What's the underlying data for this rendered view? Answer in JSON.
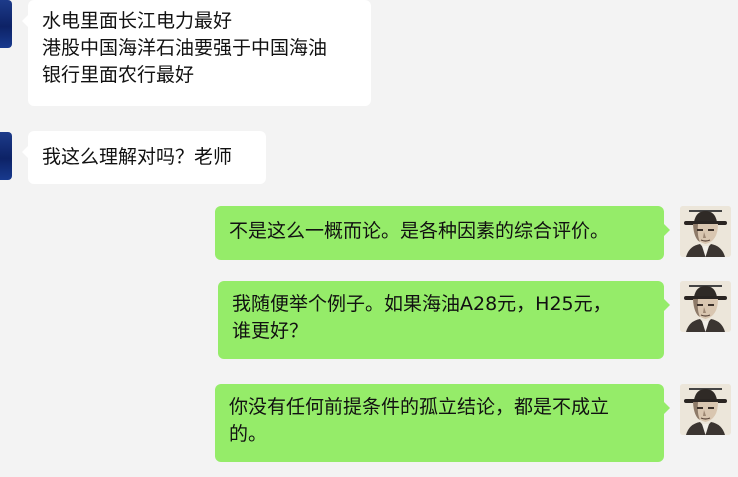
{
  "chat": {
    "messages": [
      {
        "side": "left",
        "lines": [
          "水电里面长江电力最好",
          "港股中国海洋石油要强于中国海油",
          "银行里面农行最好"
        ]
      },
      {
        "side": "left",
        "lines": [
          "我这么理解对吗？老师"
        ]
      },
      {
        "side": "right",
        "lines": [
          "不是这么一概而论。是各种因素的综合评价。"
        ]
      },
      {
        "side": "right",
        "lines": [
          "我随便举个例子。如果海油A28元，H25元，",
          "谁更好？"
        ]
      },
      {
        "side": "right",
        "lines": [
          "你没有任何前提条件的孤立结论，都是不成立",
          "的。"
        ]
      }
    ]
  },
  "colors": {
    "background": "#f3f3f3",
    "incoming_bubble": "#ffffff",
    "outgoing_bubble": "#95ec69",
    "left_avatar": "#0d2266"
  },
  "icons": {
    "left_avatar": "user-avatar-icon",
    "right_avatar": "detective-hat-avatar-icon"
  }
}
